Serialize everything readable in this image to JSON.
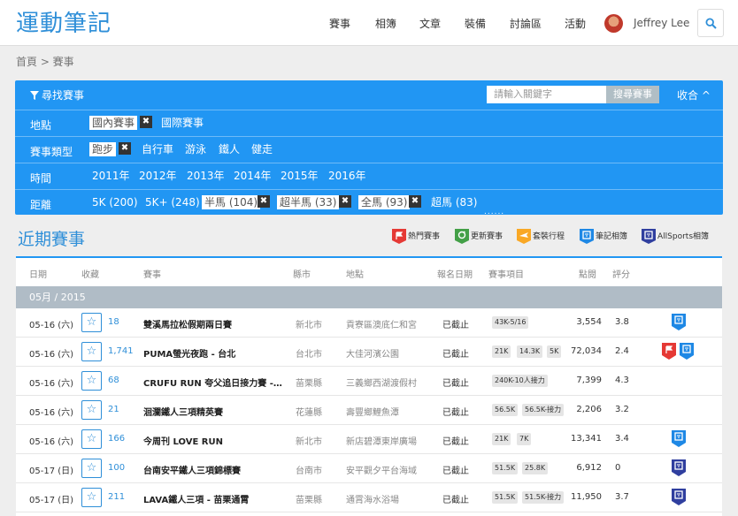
{
  "header": {
    "logo": "運動筆記",
    "nav": [
      "賽事",
      "相簿",
      "文章",
      "裝備",
      "討論區",
      "活動"
    ],
    "username": "Jeffrey Lee"
  },
  "breadcrumb": "首頁 > 賽事",
  "filter": {
    "title": "尋找賽事",
    "search_placeholder": "請輸入關鍵字",
    "search_button": "搜尋賽事",
    "collapse": "收合 ^",
    "location_label": "地點",
    "location_options": [
      "國內賽事",
      "國際賽事"
    ],
    "type_label": "賽事類型",
    "type_options": [
      "跑步",
      "自行車",
      "游泳",
      "鐵人",
      "健走"
    ],
    "time_label": "時間",
    "time_options": [
      "2011年",
      "2012年",
      "2013年",
      "2014年",
      "2015年",
      "2016年"
    ],
    "distance_label": "距離",
    "distance_options": [
      "5K (200)",
      "5K+ (248)",
      "半馬 (104)",
      "超半馬 (33)",
      "全馬 (93)",
      "超馬 (83)"
    ],
    "more": "......"
  },
  "section_title": "近期賽事",
  "legend": {
    "hot": "熱門賽事",
    "updated": "更新賽事",
    "travel": "套裝行程",
    "notes_album": "筆記相簿",
    "allsports_album": "AllSports相簿"
  },
  "colors": {
    "brand_blue": "#2196f3",
    "hot": "#e53935",
    "updated": "#43a047",
    "travel": "#f9a825",
    "notes": "#1e88e5",
    "allsports": "#303f9f"
  },
  "table": {
    "columns": [
      "日期",
      "收藏",
      "賽事",
      "縣市",
      "地點",
      "報名日期",
      "賽事項目",
      "點閱",
      "評分"
    ],
    "month_header": "05月 / 2015",
    "rows": [
      {
        "date": "05-16 (六)",
        "fav": "18",
        "name": "雙溪馬拉松假期兩日賽",
        "county": "新北市",
        "place": "貢寮區澳底仁和宮",
        "reg": "已截止",
        "tags": [
          "43K-5/16"
        ],
        "views": "3,554",
        "score": "3.8"
      },
      {
        "date": "05-16 (六)",
        "fav": "1,741",
        "name": "PUMA螢光夜跑 - 台北",
        "county": "台北市",
        "place": "大佳河濱公園",
        "reg": "已截止",
        "tags": [
          "21K",
          "14.3K",
          "5K"
        ],
        "views": "72,034",
        "score": "2.4"
      },
      {
        "date": "05-16 (六)",
        "fav": "68",
        "name": "CRUFU RUN 夸父追日接力賽 -…",
        "county": "苗栗縣",
        "place": "三義鄉西湖渡假村",
        "reg": "已截止",
        "tags": [
          "240K-10人接力"
        ],
        "views": "7,399",
        "score": "4.3"
      },
      {
        "date": "05-16 (六)",
        "fav": "21",
        "name": "洄瀾鐵人三項精英賽",
        "county": "花蓮縣",
        "place": "壽豐鄉鯉魚潭",
        "reg": "已截止",
        "tags": [
          "56.5K",
          "56.5K-接力"
        ],
        "views": "2,206",
        "score": "3.2"
      },
      {
        "date": "05-16 (六)",
        "fav": "166",
        "name": "今周刊 LOVE RUN",
        "county": "新北市",
        "place": "新店碧潭東岸廣場",
        "reg": "已截止",
        "tags": [
          "21K",
          "7K"
        ],
        "views": "13,341",
        "score": "3.4"
      },
      {
        "date": "05-17 (日)",
        "fav": "100",
        "name": "台南安平鐵人三項錦標賽",
        "county": "台南市",
        "place": "安平觀夕平台海域",
        "reg": "已截止",
        "tags": [
          "51.5K",
          "25.8K"
        ],
        "views": "6,912",
        "score": "0"
      },
      {
        "date": "05-17 (日)",
        "fav": "211",
        "name": "LAVA鐵人三項 - 苗栗通霄",
        "county": "苗栗縣",
        "place": "通霄海水浴場",
        "reg": "已截止",
        "tags": [
          "51.5K",
          "51.5K-接力"
        ],
        "views": "11,950",
        "score": "3.7"
      }
    ]
  }
}
